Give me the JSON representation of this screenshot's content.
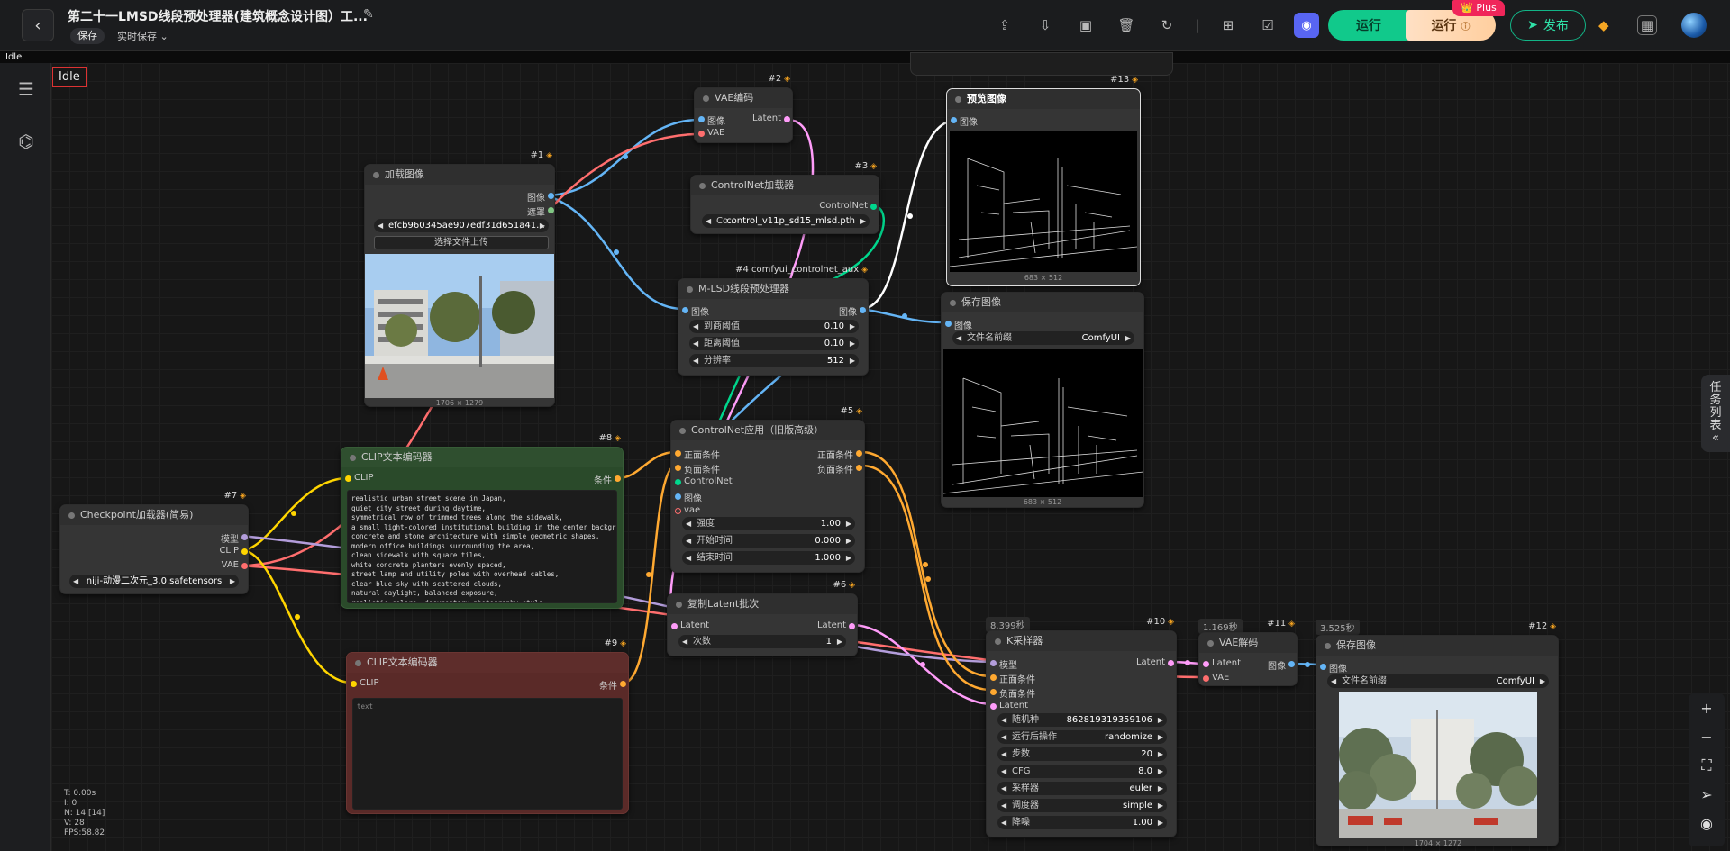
{
  "topbar": {
    "title": "第二十一LMSD线段预处理器(建筑概念设计图）工...",
    "save_label": "保存",
    "autosave_label": "实时保存",
    "run_label": "运行",
    "run_plus_label": "运行",
    "plus_badge": "Plus",
    "publish_label": "发布"
  },
  "status_strip": "Idle",
  "canvas_status": "Idle",
  "stats": {
    "t": "T: 0.00s",
    "i": "I: 0",
    "n": "N: 14 [14]",
    "v": "V: 28",
    "fps": "FPS:58.82"
  },
  "right_panel": {
    "label": "任务列表",
    "collapse": "«"
  },
  "nodes": {
    "n1": {
      "id": "#1",
      "title": "加载图像",
      "out_image": "图像",
      "out_mask": "遮罩",
      "file": "efcb960345ae907edf31d651a41...",
      "upload": "选择文件上传",
      "caption": "1706 × 1279"
    },
    "n2": {
      "id": "#2",
      "title": "VAE编码",
      "in_image": "图像",
      "in_vae": "VAE",
      "out_latent": "Latent"
    },
    "n3": {
      "id": "#3",
      "title": "ControlNet加载器",
      "out": "ControlNet",
      "w_label": "Co...",
      "w_value": "control_v11p_sd15_mlsd.pth"
    },
    "n4": {
      "id": "#4 comfyui_controlnet_aux",
      "title": "M-LSD线段预处理器",
      "in_image": "图像",
      "out_image": "图像",
      "w1_label": "到商阈值",
      "w1_value": "0.10",
      "w2_label": "距离阈值",
      "w2_value": "0.10",
      "w3_label": "分辨率",
      "w3_value": "512"
    },
    "n5": {
      "id": "#5",
      "title": "ControlNet应用（旧版高级）",
      "in_pos": "正面条件",
      "in_neg": "负面条件",
      "in_cn": "ControlNet",
      "in_img": "图像",
      "in_vae": "vae",
      "out_pos": "正面条件",
      "out_neg": "负面条件",
      "w1_label": "强度",
      "w1_value": "1.00",
      "w2_label": "开始时间",
      "w2_value": "0.000",
      "w3_label": "结束时间",
      "w3_value": "1.000"
    },
    "n6": {
      "id": "#6",
      "title": "复制Latent批次",
      "in_latent": "Latent",
      "out_latent": "Latent",
      "w_label": "次数",
      "w_value": "1"
    },
    "n7": {
      "id": "#7",
      "title": "Checkpoint加载器(简易)",
      "out_model": "模型",
      "out_clip": "CLIP",
      "out_vae": "VAE",
      "w_value": "niji-动漫二次元_3.0.safetensors"
    },
    "n8": {
      "id": "#8",
      "title": "CLIP文本编码器",
      "in_clip": "CLIP",
      "out_cond": "条件",
      "text": "realistic urban street scene in Japan,\nquiet city street during daytime,\nsymmetrical row of trimmed trees along the sidewalk,\na small light-colored institutional building in the center background,\nconcrete and stone architecture with simple geometric shapes,\nmodern office buildings surrounding the area,\nclean sidewalk with square tiles,\nwhite concrete planters evenly spaced,\nstreet lamp and utility poles with overhead cables,\nclear blue sky with scattered clouds,\nnatural daylight, balanced exposure,\nrealistic colors, documentary photography style,\nwide-angle street photo, eye-level perspective"
    },
    "n9": {
      "id": "#9",
      "title": "CLIP文本编码器",
      "in_clip": "CLIP",
      "out_cond": "条件",
      "text": "text"
    },
    "n10": {
      "id": "#10",
      "title": "K采样器",
      "time": "8.399秒",
      "in_model": "模型",
      "in_pos": "正面条件",
      "in_neg": "负面条件",
      "in_latent": "Latent",
      "out_latent": "Latent",
      "w": [
        {
          "label": "随机种",
          "value": "862819319359106"
        },
        {
          "label": "运行后操作",
          "value": "randomize"
        },
        {
          "label": "步数",
          "value": "20"
        },
        {
          "label": "CFG",
          "value": "8.0"
        },
        {
          "label": "采样器",
          "value": "euler"
        },
        {
          "label": "调度器",
          "value": "simple"
        },
        {
          "label": "降噪",
          "value": "1.00"
        }
      ]
    },
    "n11": {
      "id": "#11",
      "title": "VAE解码",
      "time": "1.169秒",
      "in_latent": "Latent",
      "in_vae": "VAE",
      "out_image": "图像"
    },
    "n12": {
      "id": "#12",
      "title": "保存图像",
      "time": "3.525秒",
      "in_image": "图像",
      "w_label": "文件名前缀",
      "w_value": "ComfyUI",
      "caption": "1704 × 1272"
    },
    "n13": {
      "id": "#13",
      "title": "预览图像",
      "in_image": "图像",
      "caption": "683 × 512"
    },
    "n14": {
      "title": "保存图像",
      "in_image": "图像",
      "w_label": "文件名前缀",
      "w_value": "ComfyUI",
      "caption": "683 × 512"
    }
  },
  "colors": {
    "image": "#64b5f6",
    "vae": "#ff6e6e",
    "latent": "#ff9cf9",
    "clip": "#ffd500",
    "conditioning": "#ffa931",
    "model": "#b39ddb",
    "controlnet": "#00d78d",
    "accent": "#11c98b"
  }
}
